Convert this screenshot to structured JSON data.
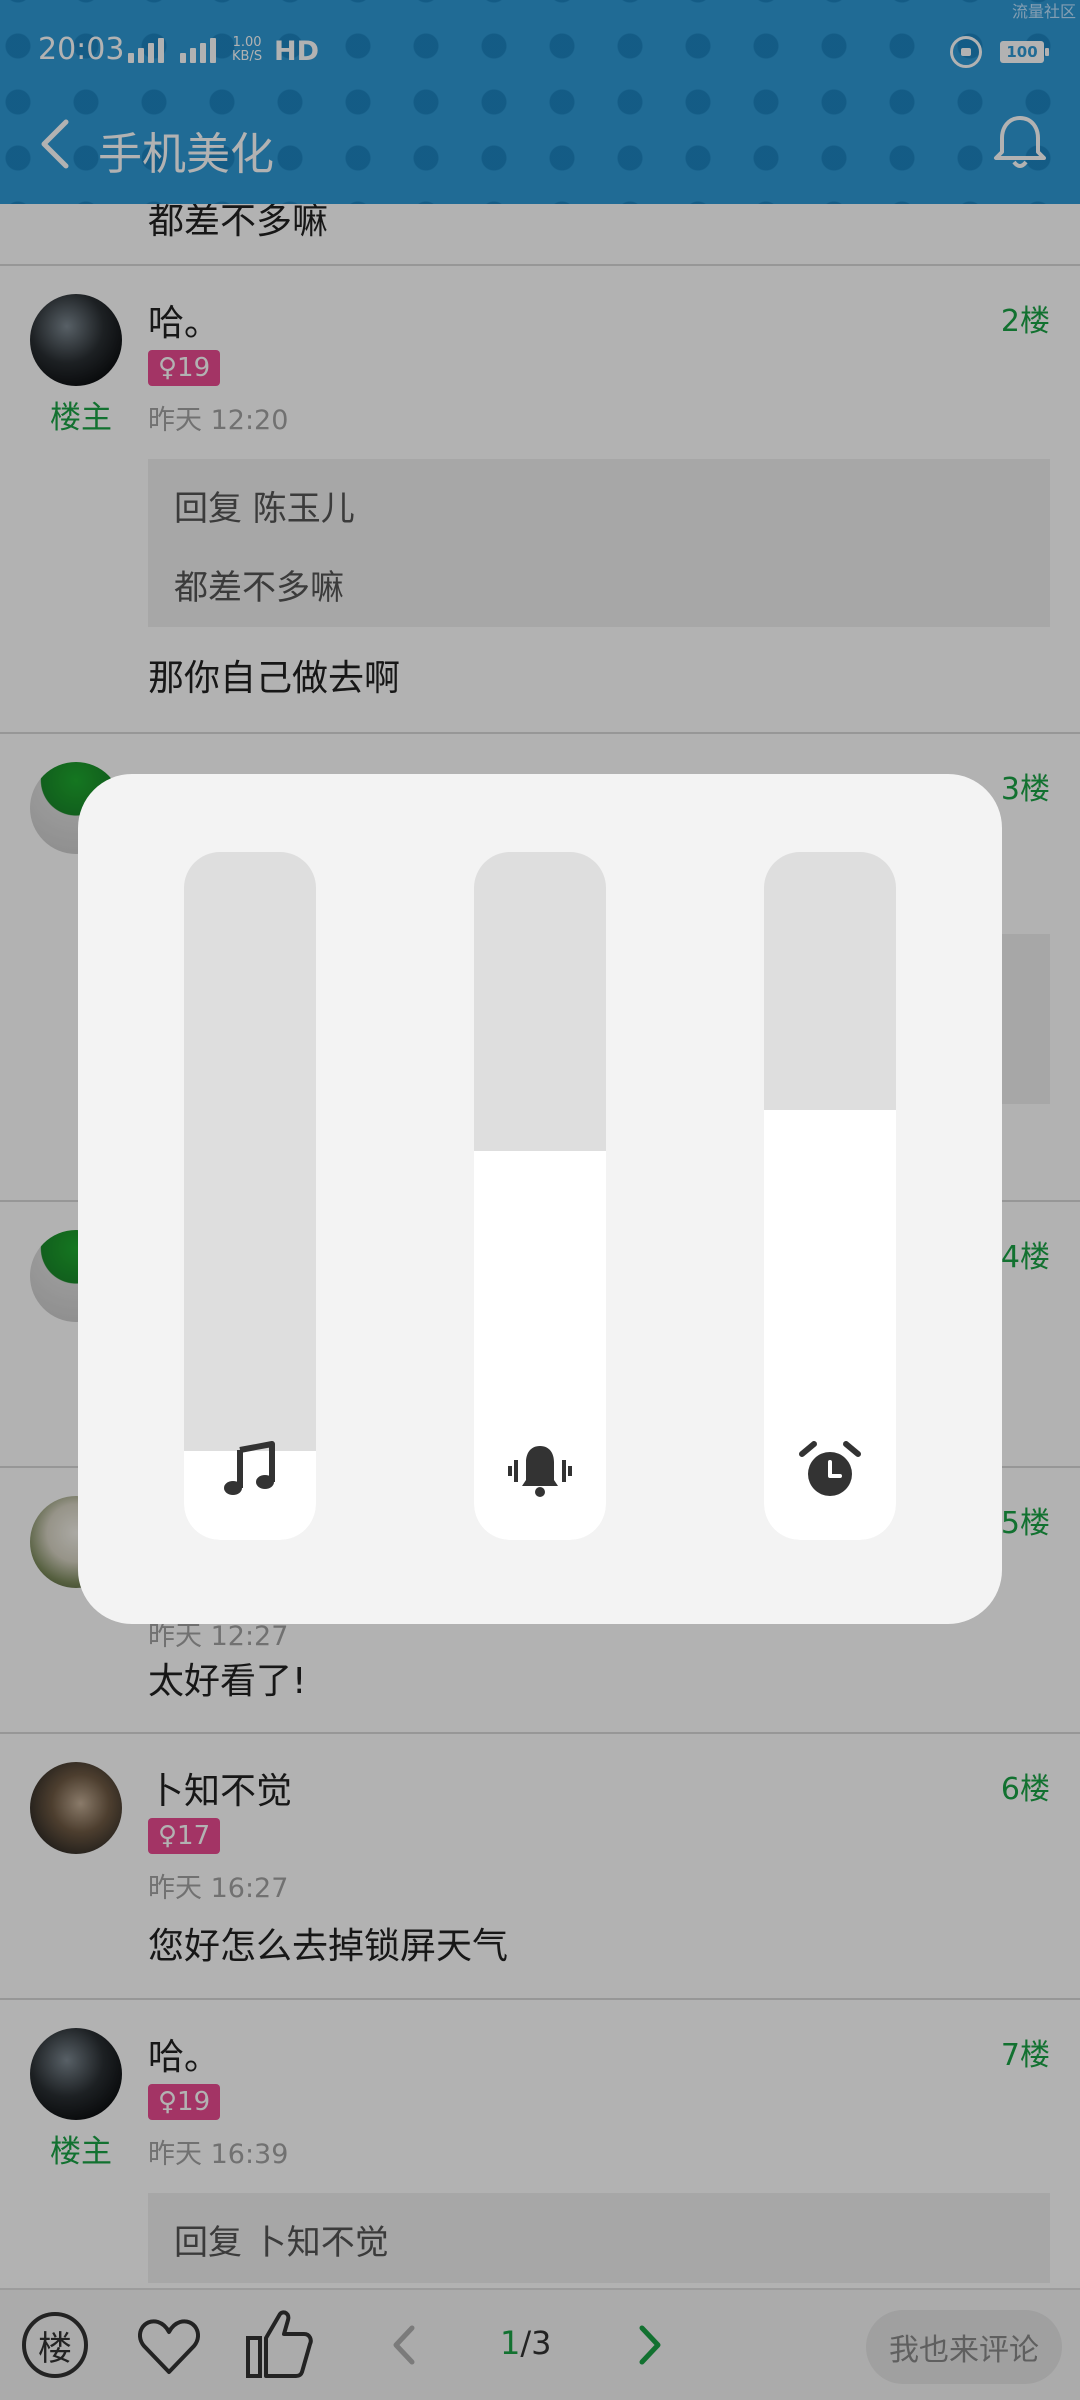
{
  "status_bar": {
    "time": "20:03",
    "net_speed_top": "1.00",
    "net_speed_unit": "KB/S",
    "hd_label": "HD",
    "battery": "100",
    "watermark": "流量社区"
  },
  "header": {
    "title": "手机美化"
  },
  "top_snippet": "都差不多嘛",
  "posts": [
    {
      "name": "哈。",
      "gender_age": "♀19",
      "op_label": "楼主",
      "time": "昨天 12:20",
      "floor": "2楼",
      "quote_title": "回复 陈玉儿",
      "quote_text": "都差不多嘛",
      "reply": "那你自己做去啊"
    },
    {
      "floor": "3楼"
    },
    {
      "floor": "4楼"
    },
    {
      "floor": "5楼",
      "time": "昨天 12:27",
      "reply": "太好看了!"
    },
    {
      "name": "卜知不觉",
      "gender_age": "♀17",
      "time": "昨天 16:27",
      "floor": "6楼",
      "reply": "您好怎么去掉锁屏天气"
    },
    {
      "name": "哈。",
      "gender_age": "♀19",
      "op_label": "楼主",
      "time": "昨天 16:39",
      "floor": "7楼",
      "quote_title": "回复 卜知不觉"
    }
  ],
  "bottom_bar": {
    "floor_button": "楼",
    "page_current": "1",
    "page_total": "/3",
    "comment_button": "我也来评论"
  },
  "volume_panel": {
    "sliders": [
      {
        "name": "media",
        "icon": "music-note-icon",
        "level_fraction": 0.13
      },
      {
        "name": "ringtone",
        "icon": "bell-vibrate-icon",
        "level_fraction": 0.565
      },
      {
        "name": "alarm",
        "icon": "alarm-clock-icon",
        "level_fraction": 0.625
      }
    ]
  },
  "colors": {
    "header_bg": "#2e9ad6",
    "accent_green": "#1aa346",
    "badge_pink": "#ea4b91"
  }
}
